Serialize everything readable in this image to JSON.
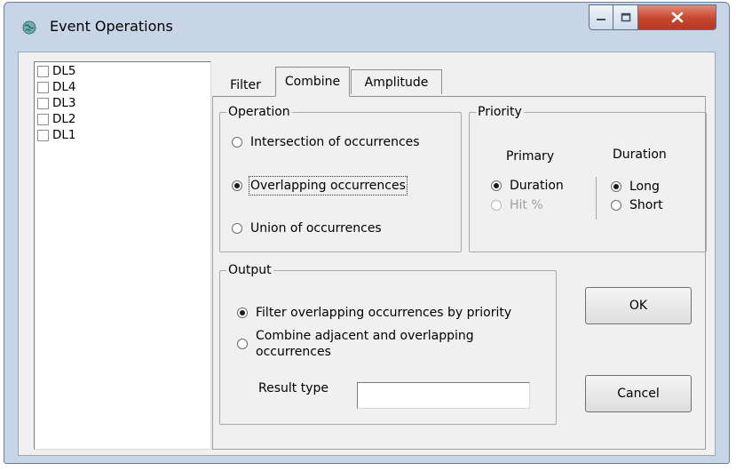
{
  "window": {
    "title": "Event Operations"
  },
  "list": {
    "items": [
      "DL5",
      "DL4",
      "DL3",
      "DL2",
      "DL1"
    ]
  },
  "tabs": [
    "Filter",
    "Combine",
    "Amplitude"
  ],
  "operation": {
    "legend": "Operation",
    "options": [
      "Intersection of occurrences",
      "Overlapping occurrences",
      "Union of occurrences"
    ],
    "selected": "Overlapping occurrences"
  },
  "priority": {
    "legend": "Priority",
    "primary_header": "Primary",
    "primary_options": [
      "Duration",
      "Hit %"
    ],
    "duration_header": "Duration",
    "duration_options": [
      "Long",
      "Short"
    ]
  },
  "output": {
    "legend": "Output",
    "option1": "Filter overlapping occurrences by priority",
    "option2_line1": "Combine adjacent and overlapping",
    "option2_line2": "occurrences",
    "result_type_label": "Result type",
    "result_type_value": ""
  },
  "buttons": {
    "ok": "OK",
    "cancel": "Cancel"
  }
}
